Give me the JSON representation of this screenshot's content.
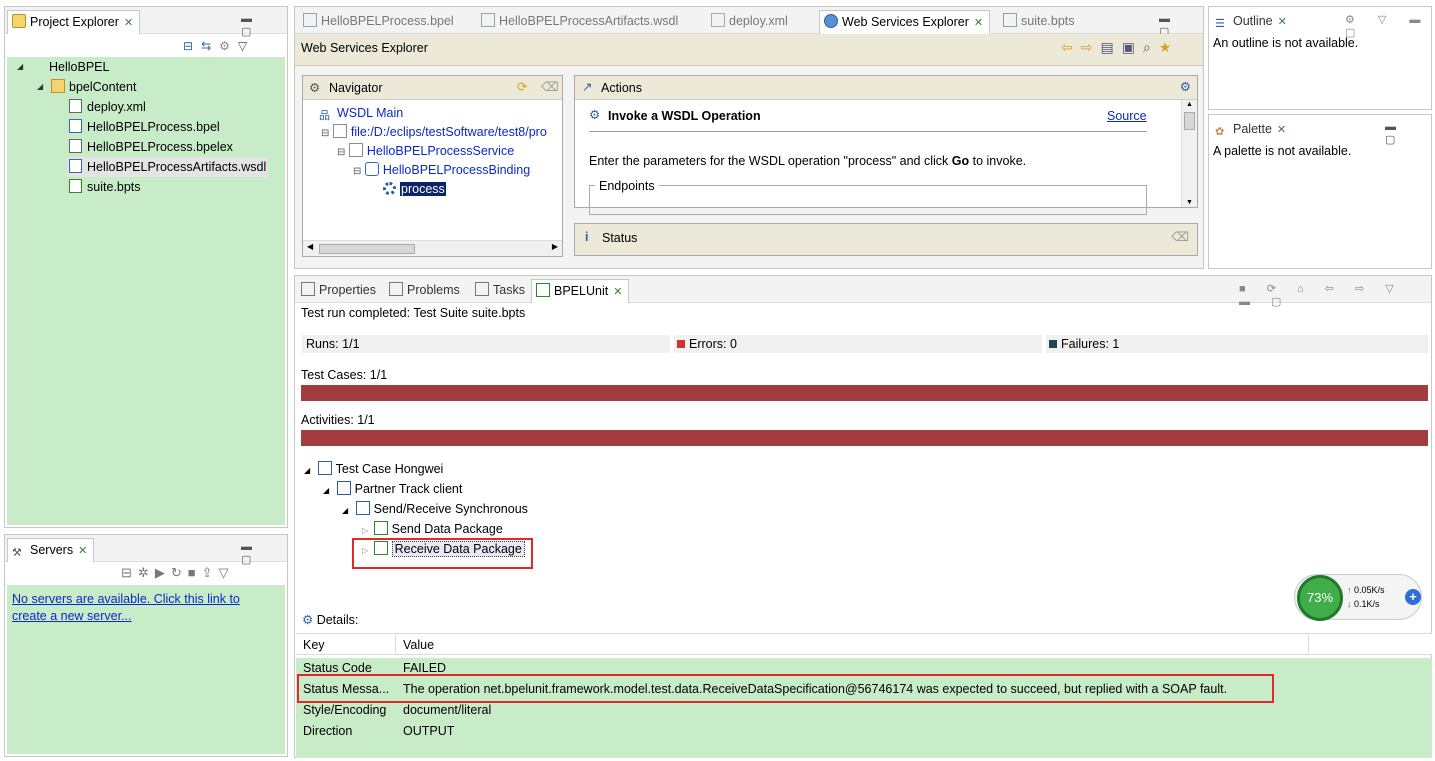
{
  "project_explorer": {
    "title": "Project Explorer",
    "items": [
      "HelloBPEL",
      "bpelContent",
      "deploy.xml",
      "HelloBPELProcess.bpel",
      "HelloBPELProcess.bpelex",
      "HelloBPELProcessArtifacts.wsdl",
      "suite.bpts"
    ]
  },
  "servers": {
    "title": "Servers",
    "message_line1": "No servers are available. Click this link to",
    "message_line2": "create a new server..."
  },
  "editor_tabs": [
    "HelloBPELProcess.bpel",
    "HelloBPELProcessArtifacts.wsdl",
    "deploy.xml",
    "Web Services Explorer",
    "suite.bpts"
  ],
  "wse": {
    "title": "Web Services Explorer",
    "navigator_title": "Navigator",
    "nav_items": [
      "WSDL Main",
      "file:/D:/eclips/testSoftware/test8/pro",
      "HelloBPELProcessService",
      "HelloBPELProcessBinding",
      "process"
    ],
    "actions_title": "Actions",
    "invoke_title": "Invoke a WSDL Operation",
    "source_link": "Source",
    "invoke_text_pre": "Enter the parameters for the WSDL operation \"process\" and click",
    "invoke_go": "Go",
    "invoke_text_post": "to invoke.",
    "endpoints": "Endpoints",
    "status_title": "Status"
  },
  "outline": {
    "title": "Outline",
    "message": "An outline is not available."
  },
  "palette": {
    "title": "Palette",
    "message": "A palette is not available."
  },
  "bottom_tabs": [
    "Properties",
    "Problems",
    "Tasks",
    "BPELUnit"
  ],
  "bpelunit": {
    "run_status": "Test run completed: Test Suite suite.bpts",
    "runs_label": "Runs:",
    "runs_value": "1/1",
    "errors_label": "Errors:",
    "errors_value": "0",
    "failures_label": "Failures:",
    "failures_value": "1",
    "testcases_label": "Test Cases: 1/1",
    "activities_label": "Activities: 1/1",
    "tree": [
      "Test Case Hongwei",
      "Partner Track client",
      "Send/Receive Synchronous",
      "Send Data Package",
      "Receive Data Package"
    ],
    "details_label": "Details:",
    "table_headers": [
      "Key",
      "Value"
    ],
    "rows": [
      {
        "key": "Status Code",
        "value": "FAILED"
      },
      {
        "key": "Status Messa...",
        "value": "The operation net.bpelunit.framework.model.test.data.ReceiveDataSpecification@56746174 was expected to succeed, but replied with a SOAP fault."
      },
      {
        "key": "Style/Encoding",
        "value": "document/literal"
      },
      {
        "key": "Direction",
        "value": "OUTPUT"
      }
    ]
  },
  "net_widget": {
    "percent": "73%",
    "up": "0.05K/s",
    "down": "0.1K/s"
  },
  "colors": {
    "accent_red": "#a33c3c",
    "highlight_red": "#e02a2a",
    "green_bg": "#c8ecc8",
    "link_blue": "#0a28c8"
  }
}
